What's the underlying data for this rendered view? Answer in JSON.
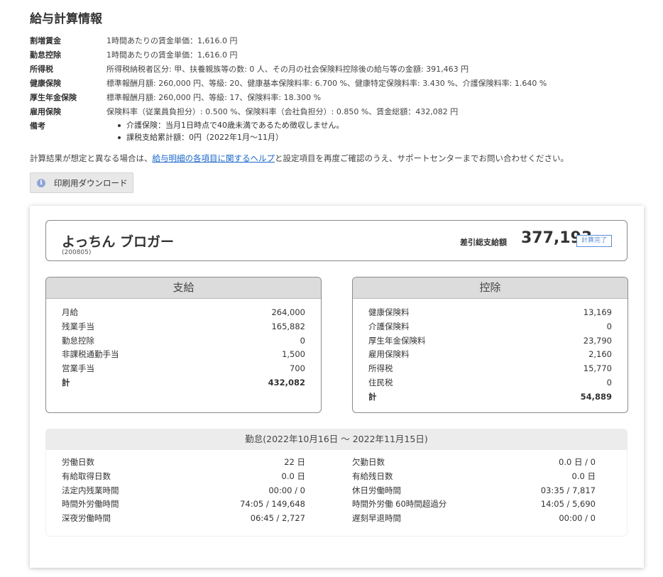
{
  "title": "給与計算情報",
  "info_rows": [
    {
      "key": "割増賃金",
      "value": "1時間あたりの賃金単価：1,616.0 円"
    },
    {
      "key": "勤怠控除",
      "value": "1時間あたりの賃金単価：1,616.0 円"
    },
    {
      "key": "所得税",
      "value": "所得税納税者区分: 甲、扶養親族等の数: 0 人、その月の社会保険料控除後の給与等の金額: 391,463 円"
    },
    {
      "key": "健康保険",
      "value": "標準報酬月額: 260,000 円、等級: 20、健康基本保険料率: 6.700 %、健康特定保険料率: 3.430 %、介護保険料率: 1.640 %"
    },
    {
      "key": "厚生年金保険",
      "value": "標準報酬月額: 260,000 円、等級: 17、保険料率: 18.300 %"
    },
    {
      "key": "雇用保険",
      "value": "保険料率（従業員負担分）: 0.500 %、保険料率（会社負担分）: 0.850 %、賃金総額：432,082 円"
    }
  ],
  "notes": {
    "key": "備考",
    "items": [
      "介護保険：当月1日時点で40歳未満であるため徴収しません。",
      "課税支給累計額：0円（2022年1月〜11月）"
    ]
  },
  "help": {
    "before": "計算結果が想定と異なる場合は、",
    "link": "給与明細の各項目に関するヘルプ",
    "after": "と設定項目を再度ご確認のうえ、サポートセンターまでお問い合わせください。"
  },
  "download_label": "印刷用ダウンロード",
  "slip": {
    "employee_name": "よっちん ブロガー",
    "employee_id": "(200805)",
    "net_label": "差引総支給額",
    "net_value": "377,193",
    "status_badge": "計算完了"
  },
  "payments": {
    "title": "支給",
    "rows": [
      {
        "label": "月給",
        "value": "264,000"
      },
      {
        "label": "残業手当",
        "value": "165,882"
      },
      {
        "label": "勤怠控除",
        "value": "0"
      },
      {
        "label": "非課税通勤手当",
        "value": "1,500"
      },
      {
        "label": "営業手当",
        "value": "700"
      }
    ],
    "total_label": "計",
    "total_value": "432,082"
  },
  "deductions": {
    "title": "控除",
    "rows": [
      {
        "label": "健康保険料",
        "value": "13,169"
      },
      {
        "label": "介護保険料",
        "value": "0"
      },
      {
        "label": "厚生年金保険料",
        "value": "23,790"
      },
      {
        "label": "雇用保険料",
        "value": "2,160"
      },
      {
        "label": "所得税",
        "value": "15,770"
      },
      {
        "label": "住民税",
        "value": "0"
      }
    ],
    "total_label": "計",
    "total_value": "54,889"
  },
  "attendance": {
    "title": "勤怠(2022年10月16日 〜 2022年11月15日)",
    "left": [
      {
        "label": "労働日数",
        "value": "22 日"
      },
      {
        "label": "有給取得日数",
        "value": "0.0 日"
      },
      {
        "label": "法定内残業時間",
        "value": "00:00 / 0"
      },
      {
        "label": "時間外労働時間",
        "value": "74:05 / 149,648"
      },
      {
        "label": "深夜労働時間",
        "value": "06:45 / 2,727"
      }
    ],
    "right": [
      {
        "label": "欠勤日数",
        "value": "0.0 日 / 0"
      },
      {
        "label": "有給残日数",
        "value": "0.0 日"
      },
      {
        "label": "休日労働時間",
        "value": "03:35 / 7,817"
      },
      {
        "label": "時間外労働 60時間超過分",
        "value": "14:05 / 5,690"
      },
      {
        "label": "遅刻早退時間",
        "value": "00:00 / 0"
      }
    ]
  }
}
